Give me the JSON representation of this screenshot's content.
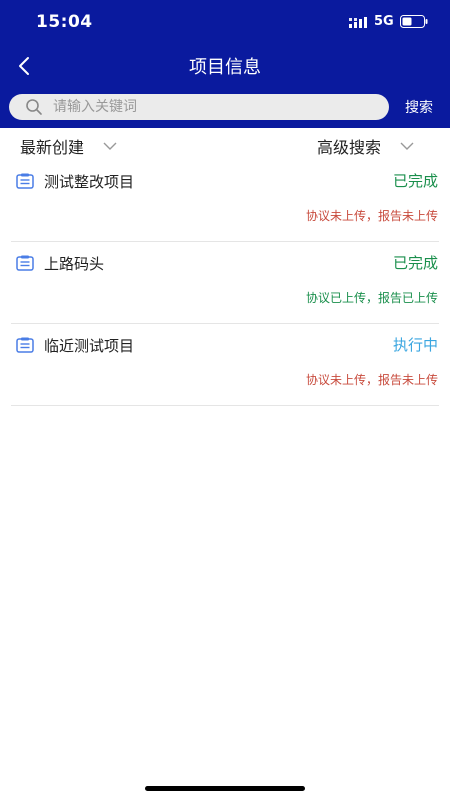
{
  "status_bar": {
    "time": "15:04",
    "network": "5G"
  },
  "header": {
    "title": "项目信息"
  },
  "search": {
    "placeholder": "请输入关键词",
    "value": "",
    "button_label": "搜索"
  },
  "filters": {
    "sort_label": "最新创建",
    "advanced_label": "高级搜索"
  },
  "projects": [
    {
      "name": "测试整改项目",
      "status": "已完成",
      "agreement": "协议未上传",
      "separator": "，",
      "report": "报告未上传",
      "status_color": "#1a8f4c",
      "info_color": "#c84b3d"
    },
    {
      "name": "上路码头",
      "status": "已完成",
      "agreement": "协议已上传",
      "separator": "，",
      "report": "报告已上传",
      "status_color": "#1a8f4c",
      "info_color": "#1a8f4c"
    },
    {
      "name": "临近测试项目",
      "status": "执行中",
      "agreement": "协议未上传",
      "separator": "，",
      "report": "报告未上传",
      "status_color": "#3aa6e0",
      "info_color": "#c84b3d"
    }
  ],
  "colors": {
    "header_bg": "#0a1a9e",
    "icon_blue": "#4a7de6"
  },
  "icons": {
    "back": "chevron-left-icon",
    "search": "search-icon",
    "dropdown": "chevron-down-icon",
    "project": "document-icon"
  }
}
